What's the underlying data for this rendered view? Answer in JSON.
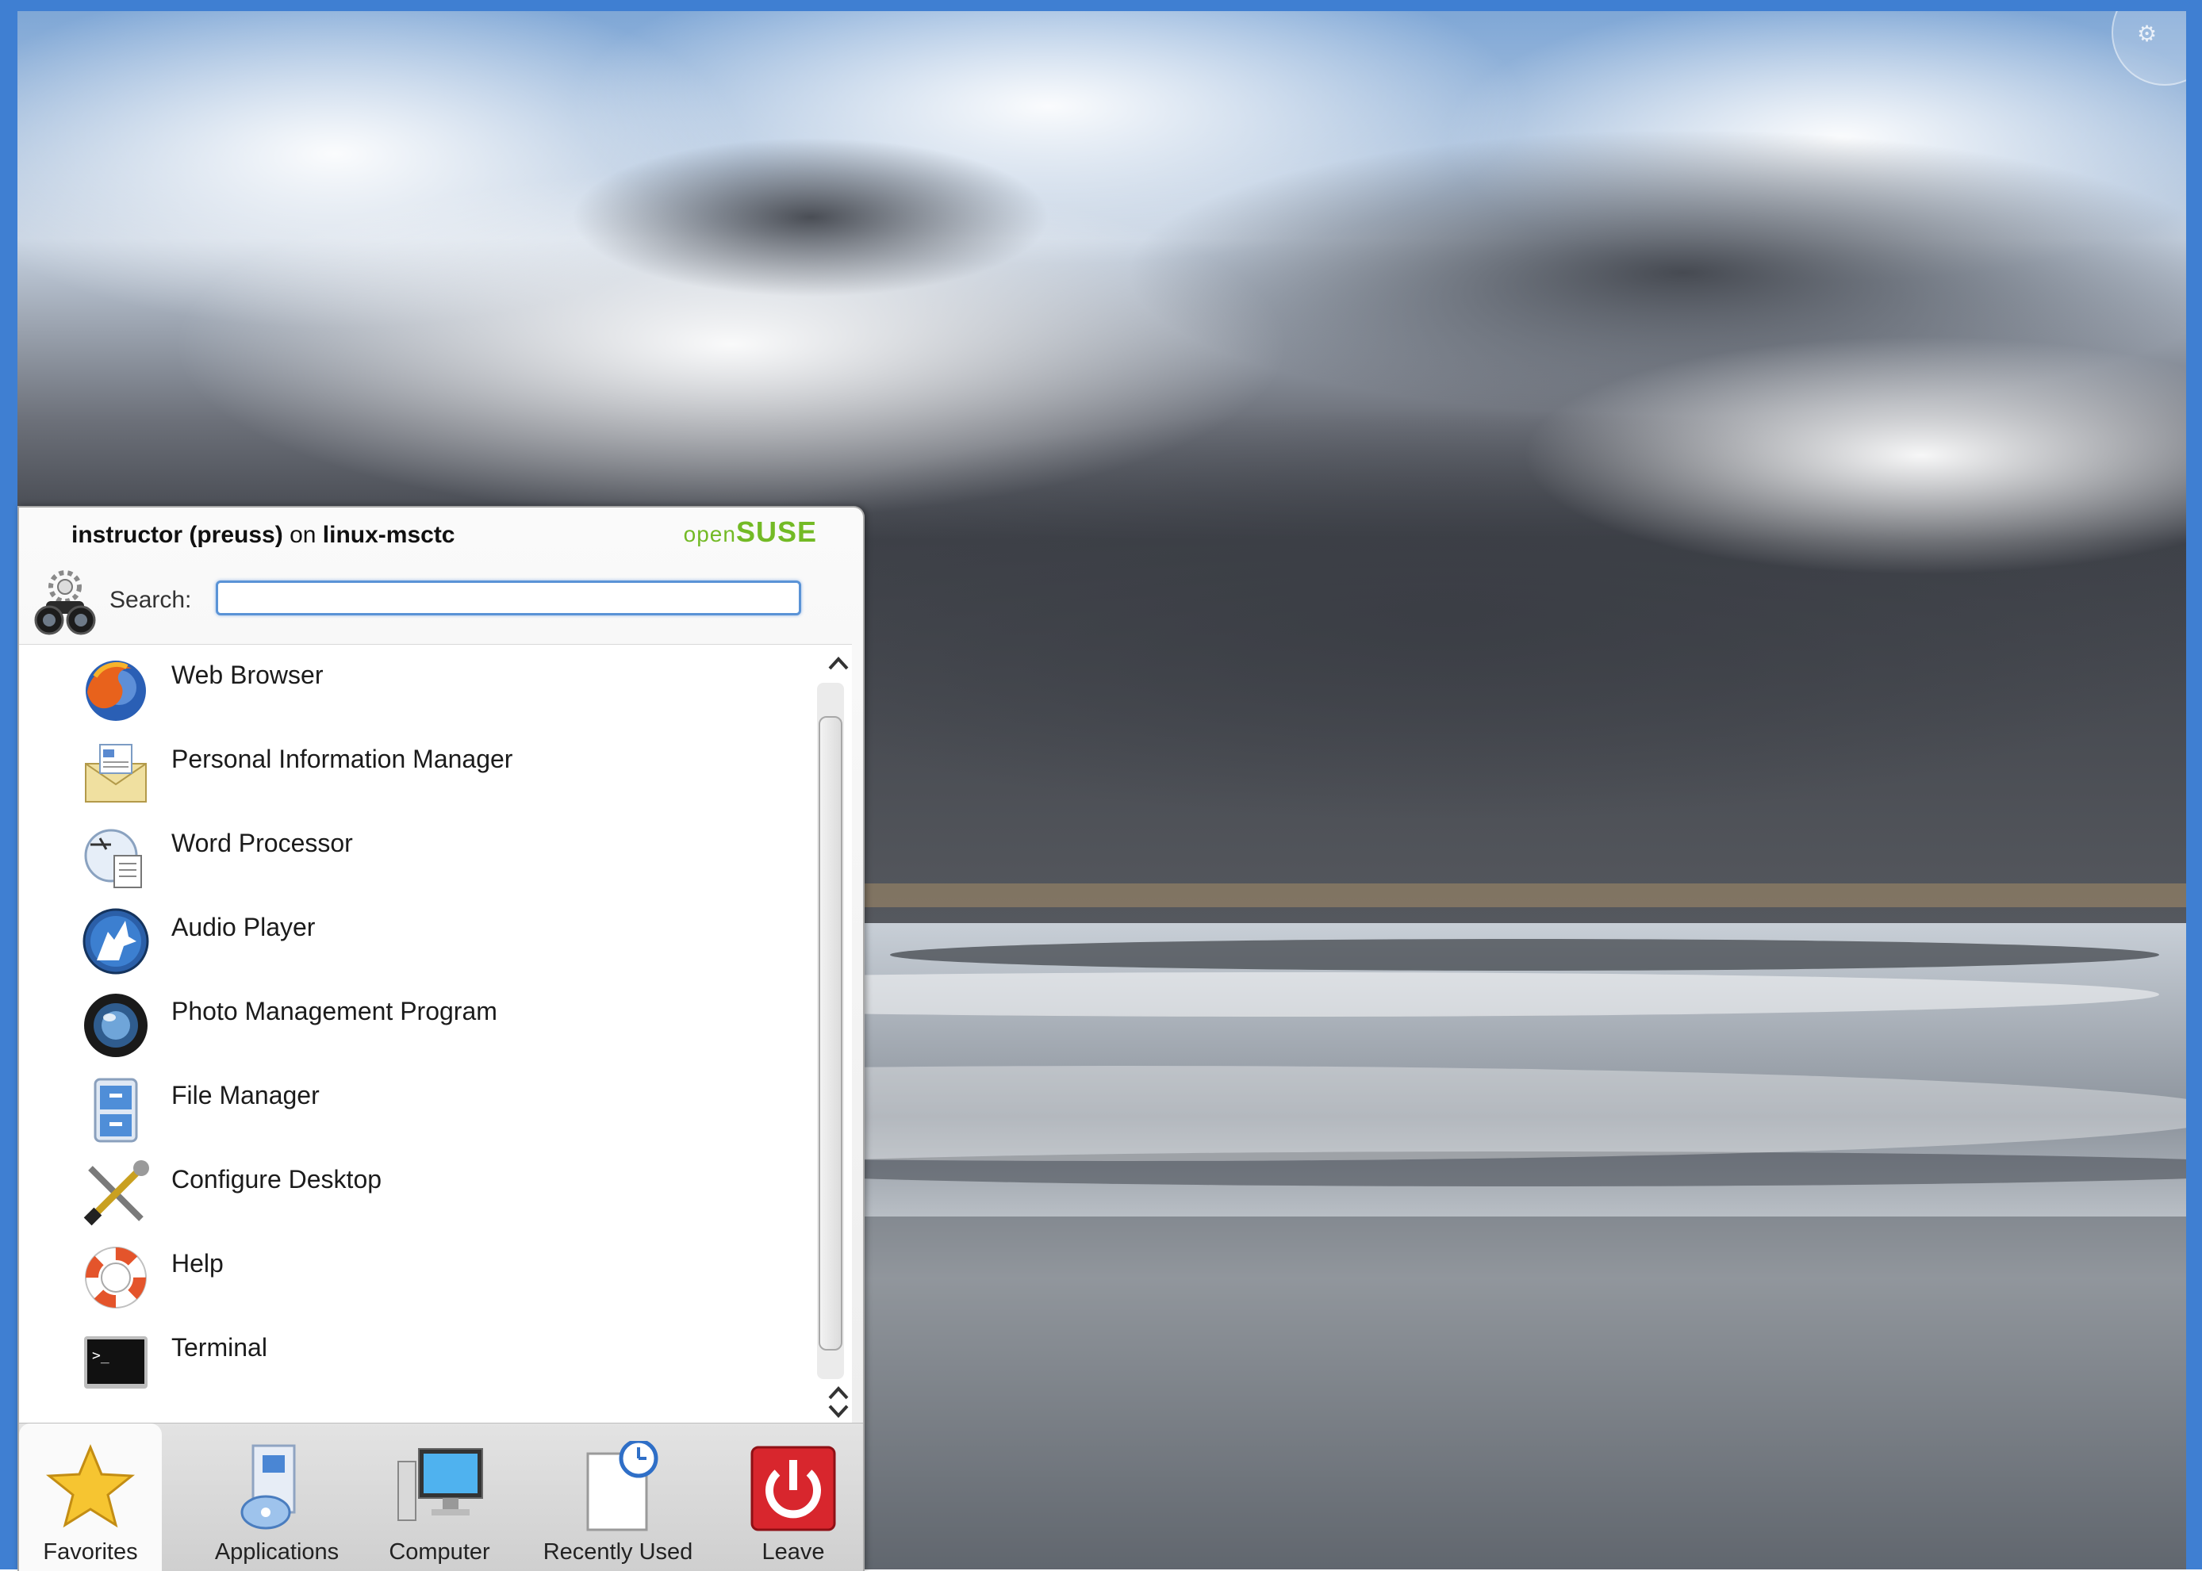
{
  "header": {
    "user": "instructor (preuss)",
    "on_word": "on",
    "host": "linux-msctc",
    "brand_open": "open",
    "brand_suse": "SUSE"
  },
  "search": {
    "label": "Search:",
    "value": "",
    "placeholder": ""
  },
  "favorites": [
    {
      "label": "Web Browser",
      "icon": "firefox-icon"
    },
    {
      "label": "Personal Information Manager",
      "icon": "kontact-icon"
    },
    {
      "label": "Word Processor",
      "icon": "word-processor-icon"
    },
    {
      "label": "Audio Player",
      "icon": "amarok-icon"
    },
    {
      "label": "Photo Management Program",
      "icon": "digikam-icon"
    },
    {
      "label": "File Manager",
      "icon": "file-cabinet-icon"
    },
    {
      "label": "Configure Desktop",
      "icon": "tools-icon"
    },
    {
      "label": "Help",
      "icon": "lifebuoy-icon"
    },
    {
      "label": "Terminal",
      "icon": "terminal-icon"
    }
  ],
  "tabs": [
    {
      "label": "Favorites",
      "icon": "star-icon",
      "active": true
    },
    {
      "label": "Applications",
      "icon": "applications-icon",
      "active": false
    },
    {
      "label": "Computer",
      "icon": "computer-icon",
      "active": false
    },
    {
      "label": "Recently Used",
      "icon": "clock-document-icon",
      "active": false
    },
    {
      "label": "Leave",
      "icon": "power-icon",
      "active": false
    }
  ],
  "colors": {
    "desktop_frame": "#3f7fd2",
    "brand_green": "#73ba25",
    "search_focus": "#5a93d6",
    "leave_red": "#d8262d"
  }
}
